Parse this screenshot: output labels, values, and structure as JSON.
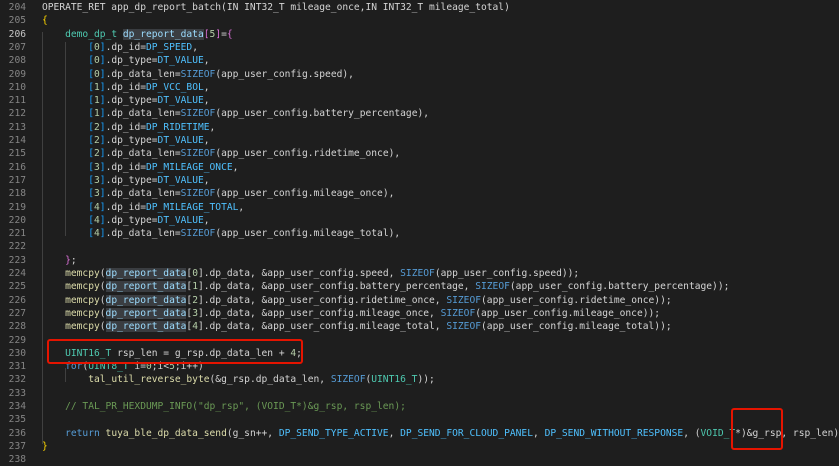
{
  "editor": {
    "lines": [
      {
        "n": "204",
        "t": [
          [
            "t-pl",
            "OPERATE_RET app_dp_report_batch(IN INT32_T mileage_once,IN INT32_T mileage_total)"
          ]
        ]
      },
      {
        "n": "205",
        "t": [
          [
            "t-brk",
            "{"
          ]
        ]
      },
      {
        "n": "206",
        "active": true,
        "t": [
          [
            "t-pl",
            "    "
          ],
          [
            "t-type",
            "demo_dp_t "
          ],
          [
            "t-hl",
            "dp_report_data"
          ],
          [
            "t-brk2",
            "["
          ],
          [
            "t-num",
            "5"
          ],
          [
            "t-brk2",
            "]"
          ],
          [
            "t-pl",
            "="
          ],
          [
            "t-brk2",
            "{"
          ]
        ]
      },
      {
        "n": "207",
        "t": [
          [
            "t-pl",
            "        "
          ],
          [
            "t-brk3",
            "["
          ],
          [
            "t-num",
            "0"
          ],
          [
            "t-brk3",
            "]"
          ],
          [
            "t-pl",
            ".dp_id="
          ],
          [
            "t-mac",
            "DP_SPEED"
          ],
          [
            "t-pl",
            ","
          ]
        ]
      },
      {
        "n": "208",
        "t": [
          [
            "t-pl",
            "        "
          ],
          [
            "t-brk3",
            "["
          ],
          [
            "t-num",
            "0"
          ],
          [
            "t-brk3",
            "]"
          ],
          [
            "t-pl",
            ".dp_type="
          ],
          [
            "t-mac",
            "DT_VALUE"
          ],
          [
            "t-pl",
            ","
          ]
        ]
      },
      {
        "n": "209",
        "t": [
          [
            "t-pl",
            "        "
          ],
          [
            "t-brk3",
            "["
          ],
          [
            "t-num",
            "0"
          ],
          [
            "t-brk3",
            "]"
          ],
          [
            "t-pl",
            ".dp_data_len="
          ],
          [
            "t-kw",
            "SIZEOF"
          ],
          [
            "t-pl",
            "(app_user_config.speed),"
          ]
        ]
      },
      {
        "n": "210",
        "t": [
          [
            "t-pl",
            "        "
          ],
          [
            "t-brk3",
            "["
          ],
          [
            "t-num",
            "1"
          ],
          [
            "t-brk3",
            "]"
          ],
          [
            "t-pl",
            ".dp_id="
          ],
          [
            "t-mac",
            "DP_VCC_BOL"
          ],
          [
            "t-pl",
            ","
          ]
        ]
      },
      {
        "n": "211",
        "t": [
          [
            "t-pl",
            "        "
          ],
          [
            "t-brk3",
            "["
          ],
          [
            "t-num",
            "1"
          ],
          [
            "t-brk3",
            "]"
          ],
          [
            "t-pl",
            ".dp_type="
          ],
          [
            "t-mac",
            "DT_VALUE"
          ],
          [
            "t-pl",
            ","
          ]
        ]
      },
      {
        "n": "212",
        "t": [
          [
            "t-pl",
            "        "
          ],
          [
            "t-brk3",
            "["
          ],
          [
            "t-num",
            "1"
          ],
          [
            "t-brk3",
            "]"
          ],
          [
            "t-pl",
            ".dp_data_len="
          ],
          [
            "t-kw",
            "SIZEOF"
          ],
          [
            "t-pl",
            "(app_user_config.battery_percentage),"
          ]
        ]
      },
      {
        "n": "213",
        "t": [
          [
            "t-pl",
            "        "
          ],
          [
            "t-brk3",
            "["
          ],
          [
            "t-num",
            "2"
          ],
          [
            "t-brk3",
            "]"
          ],
          [
            "t-pl",
            ".dp_id="
          ],
          [
            "t-mac",
            "DP_RIDETIME"
          ],
          [
            "t-pl",
            ","
          ]
        ]
      },
      {
        "n": "214",
        "t": [
          [
            "t-pl",
            "        "
          ],
          [
            "t-brk3",
            "["
          ],
          [
            "t-num",
            "2"
          ],
          [
            "t-brk3",
            "]"
          ],
          [
            "t-pl",
            ".dp_type="
          ],
          [
            "t-mac",
            "DT_VALUE"
          ],
          [
            "t-pl",
            ","
          ]
        ]
      },
      {
        "n": "215",
        "t": [
          [
            "t-pl",
            "        "
          ],
          [
            "t-brk3",
            "["
          ],
          [
            "t-num",
            "2"
          ],
          [
            "t-brk3",
            "]"
          ],
          [
            "t-pl",
            ".dp_data_len="
          ],
          [
            "t-kw",
            "SIZEOF"
          ],
          [
            "t-pl",
            "(app_user_config.ridetime_once),"
          ]
        ]
      },
      {
        "n": "216",
        "t": [
          [
            "t-pl",
            "        "
          ],
          [
            "t-brk3",
            "["
          ],
          [
            "t-num",
            "3"
          ],
          [
            "t-brk3",
            "]"
          ],
          [
            "t-pl",
            ".dp_id="
          ],
          [
            "t-mac",
            "DP_MILEAGE_ONCE"
          ],
          [
            "t-pl",
            ","
          ]
        ]
      },
      {
        "n": "217",
        "t": [
          [
            "t-pl",
            "        "
          ],
          [
            "t-brk3",
            "["
          ],
          [
            "t-num",
            "3"
          ],
          [
            "t-brk3",
            "]"
          ],
          [
            "t-pl",
            ".dp_type="
          ],
          [
            "t-mac",
            "DT_VALUE"
          ],
          [
            "t-pl",
            ","
          ]
        ]
      },
      {
        "n": "218",
        "t": [
          [
            "t-pl",
            "        "
          ],
          [
            "t-brk3",
            "["
          ],
          [
            "t-num",
            "3"
          ],
          [
            "t-brk3",
            "]"
          ],
          [
            "t-pl",
            ".dp_data_len="
          ],
          [
            "t-kw",
            "SIZEOF"
          ],
          [
            "t-pl",
            "(app_user_config.mileage_once),"
          ]
        ]
      },
      {
        "n": "219",
        "t": [
          [
            "t-pl",
            "        "
          ],
          [
            "t-brk3",
            "["
          ],
          [
            "t-num",
            "4"
          ],
          [
            "t-brk3",
            "]"
          ],
          [
            "t-pl",
            ".dp_id="
          ],
          [
            "t-mac",
            "DP_MILEAGE_TOTAL"
          ],
          [
            "t-pl",
            ","
          ]
        ]
      },
      {
        "n": "220",
        "t": [
          [
            "t-pl",
            "        "
          ],
          [
            "t-brk3",
            "["
          ],
          [
            "t-num",
            "4"
          ],
          [
            "t-brk3",
            "]"
          ],
          [
            "t-pl",
            ".dp_type="
          ],
          [
            "t-mac",
            "DT_VALUE"
          ],
          [
            "t-pl",
            ","
          ]
        ]
      },
      {
        "n": "221",
        "t": [
          [
            "t-pl",
            "        "
          ],
          [
            "t-brk3",
            "["
          ],
          [
            "t-num",
            "4"
          ],
          [
            "t-brk3",
            "]"
          ],
          [
            "t-pl",
            ".dp_data_len="
          ],
          [
            "t-kw",
            "SIZEOF"
          ],
          [
            "t-pl",
            "(app_user_config.mileage_total),"
          ]
        ]
      },
      {
        "n": "222",
        "t": []
      },
      {
        "n": "223",
        "t": [
          [
            "t-pl",
            "    "
          ],
          [
            "t-brk2",
            "}"
          ],
          [
            "t-pl",
            ";"
          ]
        ]
      },
      {
        "n": "224",
        "t": [
          [
            "t-pl",
            "    "
          ],
          [
            "t-fn",
            "memcpy"
          ],
          [
            "t-pl",
            "("
          ],
          [
            "t-hl",
            "dp_report_data"
          ],
          [
            "t-pl",
            "["
          ],
          [
            "t-num",
            "0"
          ],
          [
            "t-pl",
            "].dp_data, &app_user_config.speed, "
          ],
          [
            "t-kw",
            "SIZEOF"
          ],
          [
            "t-pl",
            "(app_user_config.speed));"
          ]
        ]
      },
      {
        "n": "225",
        "t": [
          [
            "t-pl",
            "    "
          ],
          [
            "t-fn",
            "memcpy"
          ],
          [
            "t-pl",
            "("
          ],
          [
            "t-hl",
            "dp_report_data"
          ],
          [
            "t-pl",
            "["
          ],
          [
            "t-num",
            "1"
          ],
          [
            "t-pl",
            "].dp_data, &app_user_config.battery_percentage, "
          ],
          [
            "t-kw",
            "SIZEOF"
          ],
          [
            "t-pl",
            "(app_user_config.battery_percentage));"
          ]
        ]
      },
      {
        "n": "226",
        "t": [
          [
            "t-pl",
            "    "
          ],
          [
            "t-fn",
            "memcpy"
          ],
          [
            "t-pl",
            "("
          ],
          [
            "t-hl",
            "dp_report_data"
          ],
          [
            "t-pl",
            "["
          ],
          [
            "t-num",
            "2"
          ],
          [
            "t-pl",
            "].dp_data, &app_user_config.ridetime_once, "
          ],
          [
            "t-kw",
            "SIZEOF"
          ],
          [
            "t-pl",
            "(app_user_config.ridetime_once));"
          ]
        ]
      },
      {
        "n": "227",
        "t": [
          [
            "t-pl",
            "    "
          ],
          [
            "t-fn",
            "memcpy"
          ],
          [
            "t-pl",
            "("
          ],
          [
            "t-hl",
            "dp_report_data"
          ],
          [
            "t-pl",
            "["
          ],
          [
            "t-num",
            "3"
          ],
          [
            "t-pl",
            "].dp_data, &app_user_config.mileage_once, "
          ],
          [
            "t-kw",
            "SIZEOF"
          ],
          [
            "t-pl",
            "(app_user_config.mileage_once));"
          ]
        ]
      },
      {
        "n": "228",
        "t": [
          [
            "t-pl",
            "    "
          ],
          [
            "t-fn",
            "memcpy"
          ],
          [
            "t-pl",
            "("
          ],
          [
            "t-hl",
            "dp_report_data"
          ],
          [
            "t-pl",
            "["
          ],
          [
            "t-num",
            "4"
          ],
          [
            "t-pl",
            "].dp_data, &app_user_config.mileage_total, "
          ],
          [
            "t-kw",
            "SIZEOF"
          ],
          [
            "t-pl",
            "(app_user_config.mileage_total));"
          ]
        ]
      },
      {
        "n": "229",
        "t": []
      },
      {
        "n": "230",
        "t": [
          [
            "t-pl",
            "    "
          ],
          [
            "t-type",
            "UINT16_T"
          ],
          [
            "t-pl",
            " rsp_len = g_rsp.dp_data_len + "
          ],
          [
            "t-num",
            "4"
          ],
          [
            "t-pl",
            ";"
          ]
        ]
      },
      {
        "n": "231",
        "t": [
          [
            "t-pl",
            "    "
          ],
          [
            "t-kw",
            "for"
          ],
          [
            "t-pl",
            "("
          ],
          [
            "t-type",
            "UINT8_T"
          ],
          [
            "t-pl",
            " i="
          ],
          [
            "t-num",
            "0"
          ],
          [
            "t-pl",
            ";i<"
          ],
          [
            "t-num",
            "5"
          ],
          [
            "t-pl",
            ";i++)"
          ]
        ]
      },
      {
        "n": "232",
        "t": [
          [
            "t-pl",
            "        "
          ],
          [
            "t-fn",
            "tal_util_reverse_byte"
          ],
          [
            "t-pl",
            "(&g_rsp.dp_data_len, "
          ],
          [
            "t-kw",
            "SIZEOF"
          ],
          [
            "t-pl",
            "("
          ],
          [
            "t-type",
            "UINT16_T"
          ],
          [
            "t-pl",
            "));"
          ]
        ]
      },
      {
        "n": "233",
        "t": []
      },
      {
        "n": "234",
        "t": [
          [
            "t-cmt",
            "    // TAL_PR_HEXDUMP_INFO(\"dp_rsp\", (VOID_T*)&g_rsp, rsp_len);"
          ]
        ]
      },
      {
        "n": "235",
        "t": []
      },
      {
        "n": "236",
        "t": [
          [
            "t-pl",
            "    "
          ],
          [
            "t-kw",
            "return"
          ],
          [
            "t-pl",
            " "
          ],
          [
            "t-fn",
            "tuya_ble_dp_data_send"
          ],
          [
            "t-pl",
            "(g_sn++, "
          ],
          [
            "t-mac",
            "DP_SEND_TYPE_ACTIVE"
          ],
          [
            "t-pl",
            ", "
          ],
          [
            "t-mac",
            "DP_SEND_FOR_CLOUD_PANEL"
          ],
          [
            "t-pl",
            ", "
          ],
          [
            "t-mac",
            "DP_SEND_WITHOUT_RESPONSE"
          ],
          [
            "t-pl",
            ", ("
          ],
          [
            "t-type",
            "VOID_T"
          ],
          [
            "t-pl",
            "*)&g_rsp, rsp_len);"
          ]
        ]
      },
      {
        "n": "237",
        "t": [
          [
            "t-brk",
            "}"
          ]
        ]
      },
      {
        "n": "238",
        "t": []
      }
    ]
  }
}
